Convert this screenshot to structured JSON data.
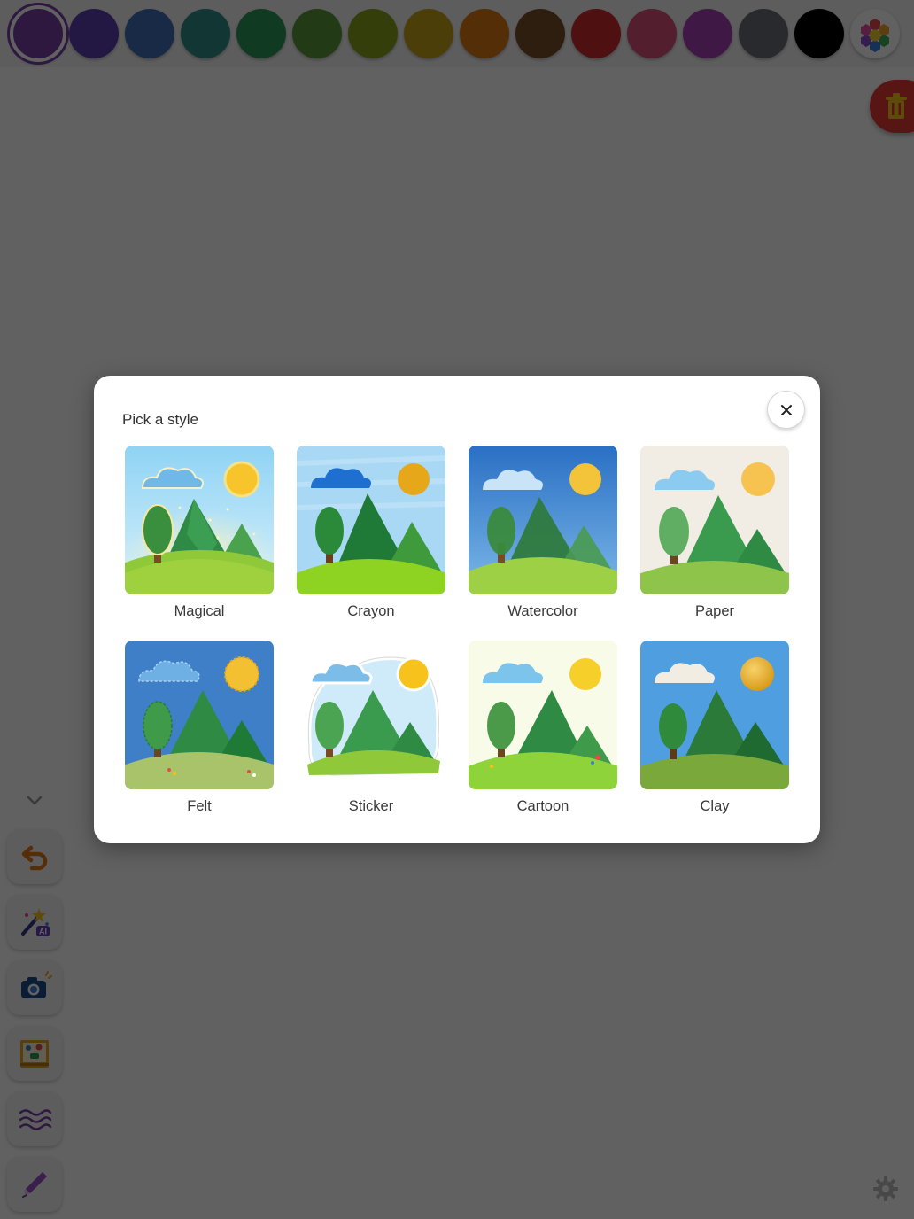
{
  "palette": {
    "swatches": [
      {
        "name": "purple",
        "color": "#7b3fa8",
        "selected": true
      },
      {
        "name": "indigo",
        "color": "#5b3fb0"
      },
      {
        "name": "blue",
        "color": "#3f6fb5"
      },
      {
        "name": "teal",
        "color": "#2f8f8a"
      },
      {
        "name": "green",
        "color": "#2f9a5a"
      },
      {
        "name": "grass",
        "color": "#5a9a38"
      },
      {
        "name": "olive",
        "color": "#8aa21e"
      },
      {
        "name": "gold",
        "color": "#c9a21a"
      },
      {
        "name": "orange",
        "color": "#d97a14"
      },
      {
        "name": "brown",
        "color": "#7a4f2a"
      },
      {
        "name": "red",
        "color": "#cc2a2a"
      },
      {
        "name": "pink",
        "color": "#d94f7a"
      },
      {
        "name": "magenta",
        "color": "#a83fb5"
      },
      {
        "name": "gray",
        "color": "#6b6f78"
      },
      {
        "name": "black",
        "color": "#000000"
      }
    ],
    "custom_picker_icon": "hexagon-color-wheel-icon"
  },
  "toolbar": {
    "collapse_icon": "chevron-down-icon",
    "tools": [
      {
        "id": "undo",
        "icon": "undo-arrow-icon"
      },
      {
        "id": "ai",
        "icon": "magic-wand-ai-icon",
        "badge": "AI"
      },
      {
        "id": "camera",
        "icon": "camera-icon"
      },
      {
        "id": "stickers",
        "icon": "sticker-book-icon"
      },
      {
        "id": "texture",
        "icon": "wavy-lines-icon"
      },
      {
        "id": "pen",
        "icon": "pen-icon"
      }
    ],
    "trash_icon": "trash-icon",
    "settings_icon": "gear-icon"
  },
  "modal": {
    "title": "Pick a style",
    "close_icon": "close-icon",
    "styles": [
      {
        "key": "magical",
        "label": "Magical"
      },
      {
        "key": "crayon",
        "label": "Crayon"
      },
      {
        "key": "watercolor",
        "label": "Watercolor"
      },
      {
        "key": "paper",
        "label": "Paper"
      },
      {
        "key": "felt",
        "label": "Felt"
      },
      {
        "key": "sticker",
        "label": "Sticker"
      },
      {
        "key": "cartoon",
        "label": "Cartoon"
      },
      {
        "key": "clay",
        "label": "Clay"
      }
    ]
  },
  "colors": {
    "overlay": "rgba(0,0,0,0.62)",
    "trash": "#e53935",
    "accent": "#7b3fa8"
  }
}
